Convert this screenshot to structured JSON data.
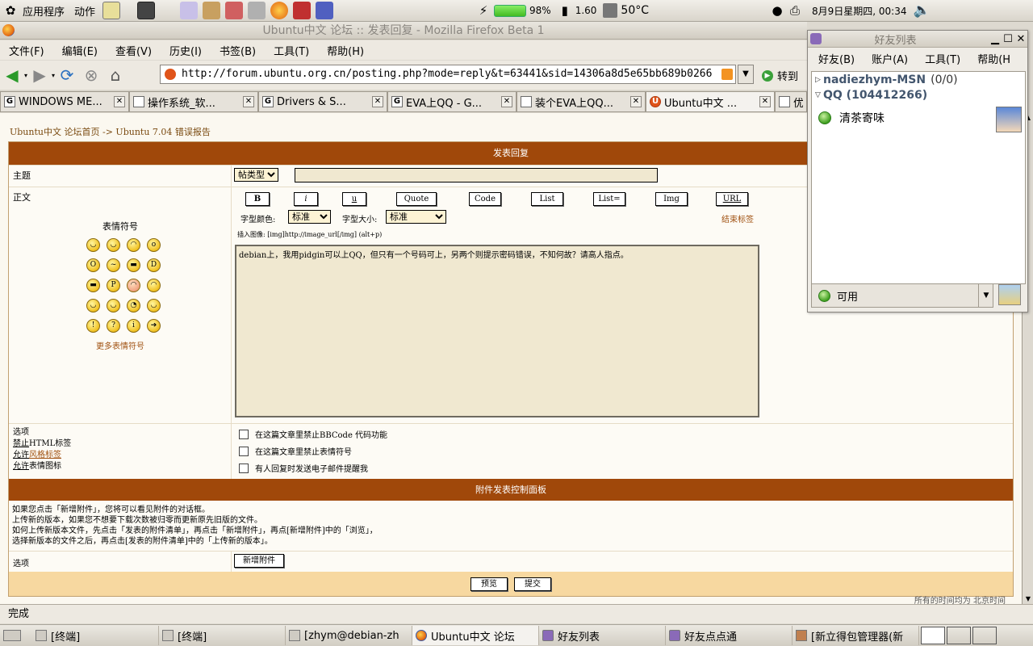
{
  "top_panel": {
    "menus": [
      "应用程序",
      "动作"
    ],
    "battery_percent": "98%",
    "cpu_freq": "1.60",
    "temperature": "50°C",
    "datetime": "8月9日星期四, 00:34"
  },
  "firefox": {
    "title": "Ubuntu中文 论坛 :: 发表回复 - Mozilla Firefox Beta 1",
    "menus": [
      "文件(F)",
      "编辑(E)",
      "查看(V)",
      "历史(I)",
      "书签(B)",
      "工具(T)",
      "帮助(H)"
    ],
    "url": "http://forum.ubuntu.org.cn/posting.php?mode=reply&t=63441&sid=14306a8d5e65bb689b0266",
    "go_label": "转到",
    "tabs": [
      {
        "icon": "G",
        "label": "WINDOWS ME..."
      },
      {
        "icon": "",
        "label": "操作系统_软..."
      },
      {
        "icon": "G",
        "label": "Drivers & S..."
      },
      {
        "icon": "G",
        "label": "EVA上QQ - G..."
      },
      {
        "icon": "",
        "label": "装个EVA上QQ..."
      },
      {
        "icon": "U",
        "label": "Ubuntu中文 ..."
      },
      {
        "icon": "",
        "label": "优"
      }
    ],
    "status": "完成"
  },
  "page": {
    "breadcrumb_home": "Ubuntu中文 论坛首页",
    "breadcrumb_sep": "->",
    "breadcrumb_forum": "Ubuntu 7.04 错误报告",
    "header": "发表回复",
    "subject_label": "主题",
    "subject_type": "帖类型",
    "body_label": "正文",
    "emoji_title": "表情符号",
    "more_emoji": "更多表情符号",
    "bb_buttons": [
      "B",
      "i",
      "u",
      "Quote",
      "Code",
      "List",
      "List=",
      "Img",
      "URL"
    ],
    "font_color_label": "字型颜色:",
    "font_color_value": "标准",
    "font_size_label": "字型大小:",
    "font_size_value": "标准",
    "close_tags": "结束标签",
    "img_hint": "插入图像: [img]http://image_url[/img]  (alt+p)",
    "post_text": "debian上，我用pidgin可以上QQ，但只有一个号码可上，另两个则提示密码错误，不知何故？请高人指点。",
    "options_label": "选项",
    "opt_html_prefix": "禁止",
    "opt_html": "HTML标签",
    "opt_style_prefix": "允许",
    "opt_style": "风格标签",
    "opt_smile_prefix": "允许",
    "opt_smile": "表情图标",
    "checkbox_1": "在这篇文章里禁止BBCode 代码功能",
    "checkbox_2": "在这篇文章里禁止表情符号",
    "checkbox_3": "有人回复时发送电子邮件提醒我",
    "attach_header": "附件发表控制面板",
    "attach_line_1": "如果您点击「新增附件」，您将可以看见附件的对话框。",
    "attach_line_2": "上传新的版本，如果您不想要下载次数被归零而更新原先旧版的文件。",
    "attach_line_3": "如何上传新版本文件，先点击「发表的附件清单」，再点击「新增附件」，再点[新增附件]中的「浏览」，",
    "attach_line_4": "选择新版本的文件之后，再点击[发表的附件清单]中的「上传新的版本」。",
    "attach_options_label": "选项",
    "add_attach_btn": "新增附件",
    "preview_btn": "预览",
    "submit_btn": "提交",
    "footer_text": "所有的时间均为 北京时间"
  },
  "buddy_list": {
    "title": "好友列表",
    "menus": [
      "好友(B)",
      "账户(A)",
      "工具(T)",
      "帮助(H"
    ],
    "group_msn": "nadiezhym-MSN",
    "group_msn_count": "(0/0)",
    "group_qq": "QQ (104412266)",
    "buddy_name": "清茶寄味",
    "status": "可用"
  },
  "taskbar": {
    "tasks": [
      "[终端]",
      "[终端]",
      "[zhym@debian-zh",
      "Ubuntu中文 论坛",
      "好友列表",
      "好友点点通",
      "[新立得包管理器(新"
    ]
  }
}
